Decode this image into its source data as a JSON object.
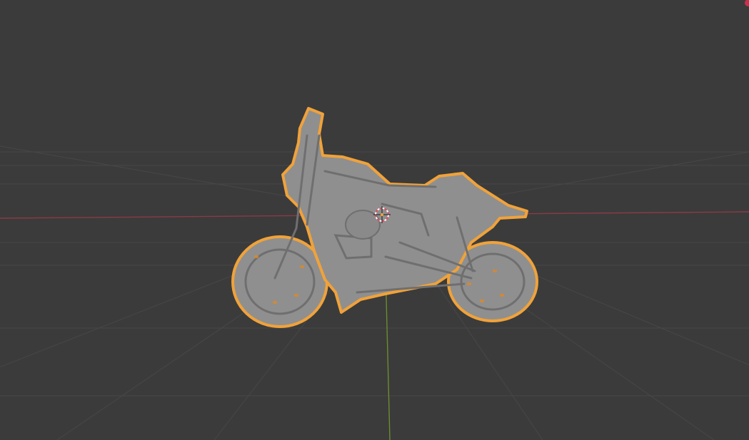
{
  "viewport": {
    "background_color": "#3b3b3b",
    "grid_color": "#474747",
    "x_axis_color": "#8b3a46",
    "y_axis_color": "#6a8d2e"
  },
  "object": {
    "name_semantic": "motorcycle-mesh",
    "mesh_color": "#8f8f8f",
    "mesh_shadow_color": "#6f6f6f",
    "selection_outline_color": "#f0a23a",
    "selected": true
  },
  "cursor": {
    "icon": "3d-cursor-icon",
    "ring_color_a": "#e04b5a",
    "ring_color_b": "#ffffff"
  },
  "gizmo": {
    "icon": "navigation-gizmo-icon",
    "color": "#d9304f"
  }
}
